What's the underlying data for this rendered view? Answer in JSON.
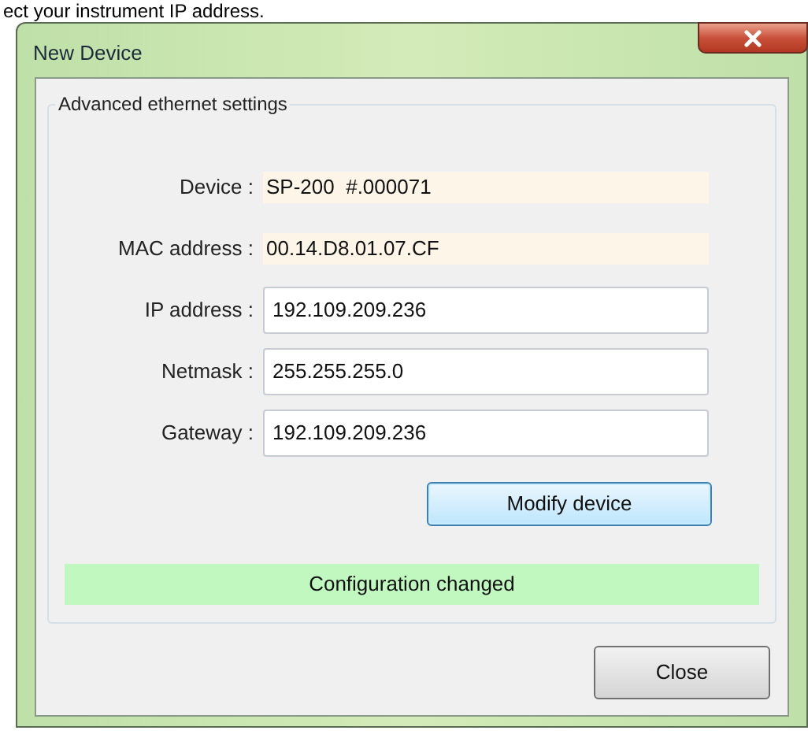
{
  "background_text": "ect your instrument IP address.",
  "window": {
    "title": "New Device"
  },
  "group": {
    "title": "Advanced ethernet settings",
    "fields": [
      {
        "label": "Device :",
        "value": "SP-200  #.000071",
        "kind": "readonly"
      },
      {
        "label": "MAC address :",
        "value": "00.14.D8.01.07.CF",
        "kind": "readonly"
      },
      {
        "label": "IP address :",
        "value": "192.109.209.236",
        "kind": "input"
      },
      {
        "label": "Netmask :",
        "value": "255.255.255.0",
        "kind": "input"
      },
      {
        "label": "Gateway :",
        "value": "192.109.209.236",
        "kind": "input"
      }
    ],
    "button": "Modify device",
    "status": "Configuration changed"
  },
  "buttons": [
    "Close"
  ]
}
